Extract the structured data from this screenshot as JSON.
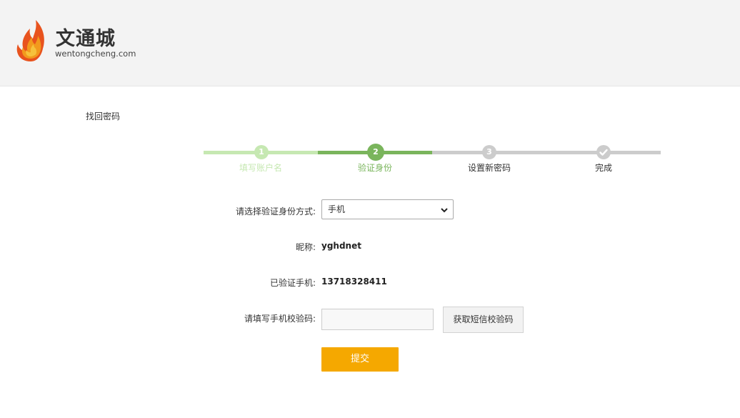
{
  "brand": {
    "name": "文通城",
    "domain": "wentongcheng.com",
    "flame_colors": [
      "#e8531e",
      "#f29a1d",
      "#f6c23c"
    ]
  },
  "page": {
    "title": "找回密码"
  },
  "steps": {
    "current": 2,
    "items": [
      {
        "number": "1",
        "label": "填写账户名",
        "state": "done"
      },
      {
        "number": "2",
        "label": "验证身份",
        "state": "active"
      },
      {
        "number": "3",
        "label": "设置新密码",
        "state": "todo"
      },
      {
        "number": "",
        "label": "完成",
        "icon": "check-icon",
        "state": "todo"
      }
    ],
    "colors": {
      "done": "#c6e8b2",
      "active": "#7ab55c",
      "todo": "#cccccc"
    }
  },
  "form": {
    "method_label": "请选择验证身份方式:",
    "method_value": "手机",
    "nickname_label": "昵称:",
    "nickname_value": "yghdnet",
    "phone_label": "已验证手机:",
    "phone_value": "13718328411",
    "code_label": "请填写手机校验码:",
    "code_value": "",
    "code_placeholder": "",
    "sms_button": "获取短信校验码",
    "submit_button": "提交"
  },
  "colors": {
    "submit": "#f5a800",
    "header_bg": "#f3f3f3"
  }
}
